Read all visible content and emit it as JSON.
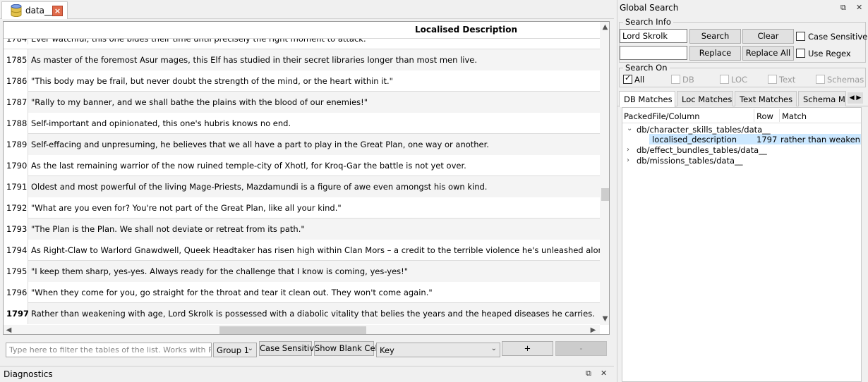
{
  "tab": {
    "label": "data__",
    "close": "×"
  },
  "table": {
    "column_header": "Localised Description",
    "partial_row": {
      "num": "1784",
      "text": "Ever watchful, this one bides their time until precisely the right moment to attack."
    },
    "rows": [
      {
        "num": "1785",
        "text": "As master of the foremost Asur mages, this Elf has studied in their secret libraries longer than most men live."
      },
      {
        "num": "1786",
        "text": "\"This body may be frail, but never doubt the strength of the mind, or the heart within it.\""
      },
      {
        "num": "1787",
        "text": "\"Rally to my banner, and we shall bathe the plains with the blood of our enemies!\""
      },
      {
        "num": "1788",
        "text": "Self-important and opinionated, this one's hubris knows no end."
      },
      {
        "num": "1789",
        "text": "Self-effacing and unpresuming, he believes that we all have a part to play in the Great Plan, one way or another."
      },
      {
        "num": "1790",
        "text": "As the last remaining warrior of the now ruined temple-city of Xhotl, for Kroq-Gar the battle is not yet over."
      },
      {
        "num": "1791",
        "text": "Oldest and most powerful of the living Mage-Priests, Mazdamundi is a figure of awe even amongst his own kind."
      },
      {
        "num": "1792",
        "text": "\"What are you even for? You're not part of the Great Plan, like all your kind.\""
      },
      {
        "num": "1793",
        "text": "\"The Plan is the Plan. We shall not deviate or retreat from its path.\""
      },
      {
        "num": "1794",
        "text": "As Right-Claw to Warlord Gnawdwell, Queek Headtaker has risen high within Clan Mors – a credit to the terrible violence he's unleashed along the way."
      },
      {
        "num": "1795",
        "text": "\"I keep them sharp, yes-yes. Always ready for the challenge that I know is coming, yes-yes!\""
      },
      {
        "num": "1796",
        "text": "\"When they come for you, go straight for the throat and tear it clean out. They won't come again.\""
      },
      {
        "num": "1797",
        "text": "Rather than weakening with age, Lord Skrolk is possessed with a diabolic vitality that belies the years and the heaped diseases he carries."
      }
    ]
  },
  "filter": {
    "placeholder": "Type here to filter the tables of the list. Works with Rege...",
    "group": "Group 1",
    "case_sensitive": "Case Sensitive",
    "show_blank": "Show Blank Cells",
    "column": "Key",
    "add": "+",
    "remove": "-"
  },
  "diagnostics": {
    "title": "Diagnostics"
  },
  "global_search": {
    "title": "Global Search",
    "search_info": "Search Info",
    "search_value": "Lord Skrolk",
    "replace_value": "",
    "search": "Search",
    "clear": "Clear",
    "replace": "Replace",
    "replace_all": "Replace All",
    "case_sensitive": "Case Sensitive",
    "use_regex": "Use Regex",
    "search_on": "Search On",
    "targets": [
      "All",
      "DB",
      "LOC",
      "Text",
      "Schemas"
    ],
    "tabs": [
      "DB Matches",
      "Loc Matches",
      "Text Matches",
      "Schema Matc"
    ],
    "results_headers": [
      "PackedFile/Column",
      "Row",
      "Match"
    ],
    "results": [
      {
        "path": "db/character_skills_tables/data__",
        "expanded": true,
        "children": [
          {
            "column": "localised_description",
            "row": "1797",
            "match": "rather than weakeni..."
          }
        ]
      },
      {
        "path": "db/effect_bundles_tables/data__",
        "expanded": false
      },
      {
        "path": "db/missions_tables/data__",
        "expanded": false
      }
    ]
  }
}
